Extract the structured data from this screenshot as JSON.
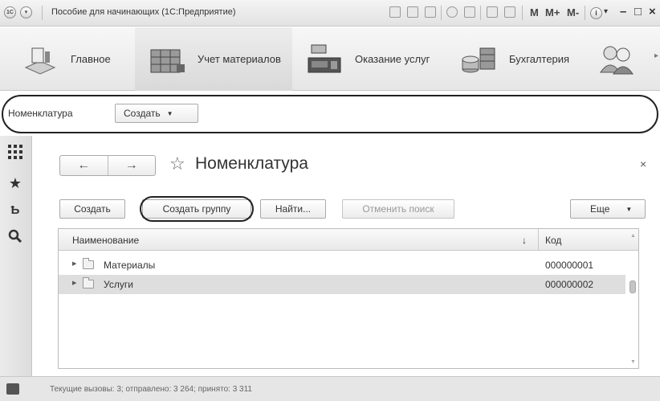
{
  "window": {
    "title": "Пособие для начинающих  (1С:Предприятие)",
    "logo_text": "1С",
    "toolbar_m": "M",
    "toolbar_mplus": "M+",
    "toolbar_mminus": "M-",
    "info_glyph": "i",
    "minimize_glyph": "–",
    "maximize_glyph": "□",
    "close_glyph": "×"
  },
  "sections": [
    {
      "label": "Главное",
      "icon": "home-desk-icon"
    },
    {
      "label": "Учет материалов",
      "icon": "warehouse-icon"
    },
    {
      "label": "Оказание услуг",
      "icon": "cash-register-icon"
    },
    {
      "label": "Бухгалтерия",
      "icon": "coins-icon"
    },
    {
      "label": "",
      "icon": "people-icon"
    }
  ],
  "nav_panel": {
    "item": "Номенклатура",
    "create_label": "Создать"
  },
  "left_toolbar": [
    "apps-grid-icon",
    "star-icon",
    "history-icon",
    "search-icon"
  ],
  "form": {
    "title": "Номенклатура",
    "back_glyph": "←",
    "forward_glyph": "→",
    "star_glyph": "☆",
    "close_glyph": "×"
  },
  "command_bar": {
    "create": "Создать",
    "create_group": "Создать группу",
    "find": "Найти...",
    "cancel_search": "Отменить поиск",
    "more": "Еще"
  },
  "table": {
    "columns": [
      "Наименование",
      "Код"
    ],
    "sort_glyph": "↓",
    "rows": [
      {
        "name": "Материалы",
        "code": "000000001"
      },
      {
        "name": "Услуги",
        "code": "000000002"
      }
    ]
  },
  "status": {
    "text": "Текущие вызовы: 3; отправлено: 3 264; принято: 3 311"
  }
}
